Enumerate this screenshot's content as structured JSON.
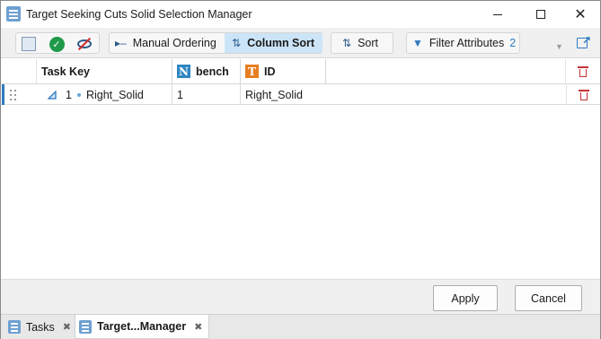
{
  "window": {
    "title": "Target Seeking Cuts Solid Selection Manager",
    "accent_color": "#2f7ac0"
  },
  "toolbar": {
    "image_icon": "image-icon",
    "accept_icon": "checkmark-circle-icon",
    "hide_icon": "hide-eye-icon",
    "manual_ordering": "Manual Ordering",
    "column_sort": "Column Sort",
    "sort": "Sort",
    "filter_attributes": "Filter Attributes",
    "filter_count": "2",
    "active_mode": "Column Sort"
  },
  "grid": {
    "columns": [
      {
        "key": "task_key",
        "label": "Task Key",
        "type_icon": ""
      },
      {
        "key": "bench",
        "label": "bench",
        "type_icon": "N"
      },
      {
        "key": "id",
        "label": "ID",
        "type_icon": "T"
      }
    ],
    "rows": [
      {
        "index": "1",
        "task_key": "Right_Solid",
        "bench": "1",
        "id": "Right_Solid"
      }
    ]
  },
  "footer": {
    "apply": "Apply",
    "cancel": "Cancel"
  },
  "tabs": [
    {
      "label": "Tasks",
      "active": false
    },
    {
      "label": "Target...Manager",
      "active": true
    }
  ]
}
